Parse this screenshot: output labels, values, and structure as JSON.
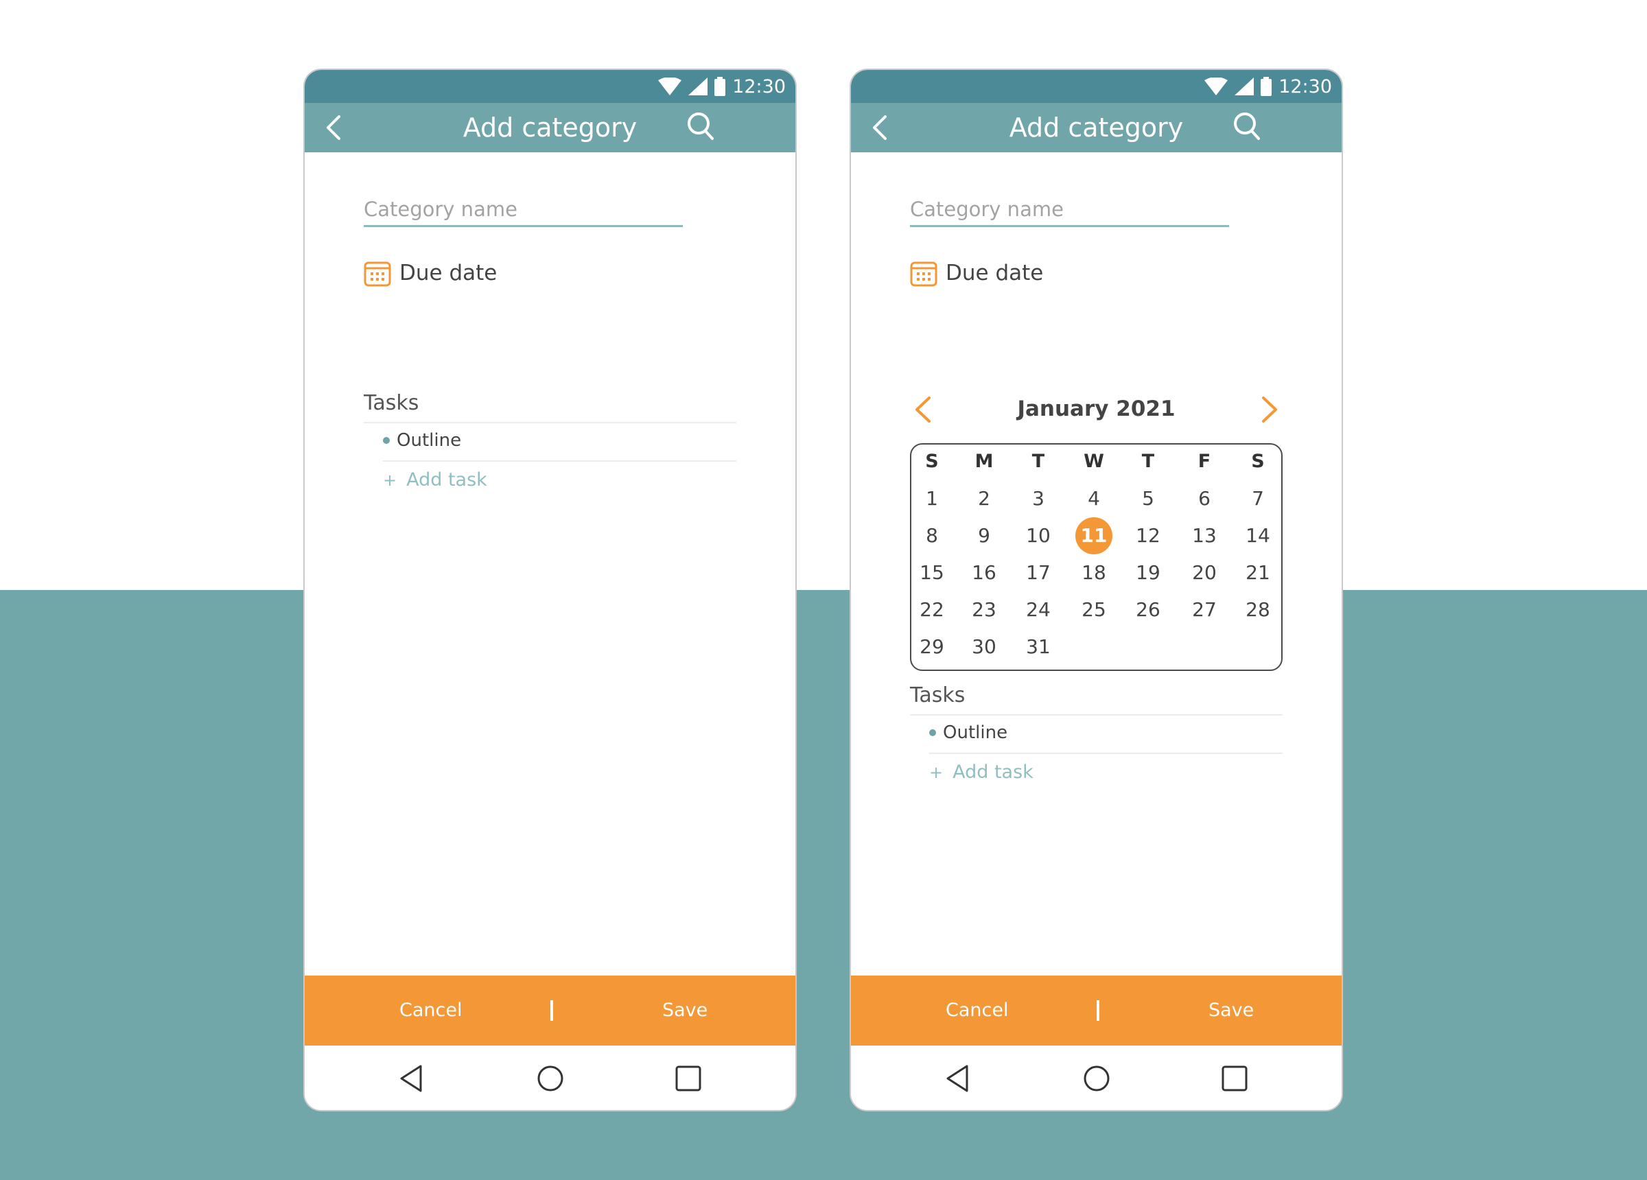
{
  "colors": {
    "statusbar": "#4b8a96",
    "appbar": "#70a5aa",
    "accent": "#f49736",
    "background_band": "#72a7aa",
    "link": "#8fbfc2"
  },
  "screens": [
    {
      "status": {
        "time": "12:30",
        "icons": [
          "wifi-icon",
          "signal-icon",
          "battery-icon"
        ]
      },
      "appbar": {
        "title": "Add category",
        "back_icon": "chevron-left-icon",
        "search_icon": "search-icon"
      },
      "form": {
        "category_placeholder": "Category name",
        "due_date_label": "Due date",
        "due_date_icon": "calendar-icon"
      },
      "tasks": {
        "heading": "Tasks",
        "items": [
          "Outline"
        ],
        "add_label": "Add task",
        "add_icon": "plus-icon"
      },
      "actions": {
        "cancel": "Cancel",
        "separator": "|",
        "save": "Save"
      },
      "nav": {
        "icons": [
          "nav-back-icon",
          "nav-home-icon",
          "nav-recents-icon"
        ]
      }
    },
    {
      "status": {
        "time": "12:30",
        "icons": [
          "wifi-icon",
          "signal-icon",
          "battery-icon"
        ]
      },
      "appbar": {
        "title": "Add category",
        "back_icon": "chevron-left-icon",
        "search_icon": "search-icon"
      },
      "form": {
        "category_placeholder": "Category name",
        "due_date_label": "Due date",
        "due_date_icon": "calendar-icon"
      },
      "calendar": {
        "month_label": "January 2021",
        "prev_icon": "chevron-left-icon",
        "next_icon": "chevron-right-icon",
        "weekdays": [
          "S",
          "M",
          "T",
          "W",
          "T",
          "F",
          "S"
        ],
        "weeks": [
          [
            "1",
            "2",
            "3",
            "4",
            "5",
            "6",
            "7"
          ],
          [
            "8",
            "9",
            "10",
            "11",
            "12",
            "13",
            "14"
          ],
          [
            "15",
            "16",
            "17",
            "18",
            "19",
            "20",
            "21"
          ],
          [
            "22",
            "23",
            "24",
            "25",
            "26",
            "27",
            "28"
          ],
          [
            "29",
            "30",
            "31",
            "",
            "",
            "",
            ""
          ]
        ],
        "selected_day": "11"
      },
      "tasks": {
        "heading": "Tasks",
        "items": [
          "Outline"
        ],
        "add_label": "Add task",
        "add_icon": "plus-icon"
      },
      "actions": {
        "cancel": "Cancel",
        "separator": "|",
        "save": "Save"
      },
      "nav": {
        "icons": [
          "nav-back-icon",
          "nav-home-icon",
          "nav-recents-icon"
        ]
      }
    }
  ]
}
